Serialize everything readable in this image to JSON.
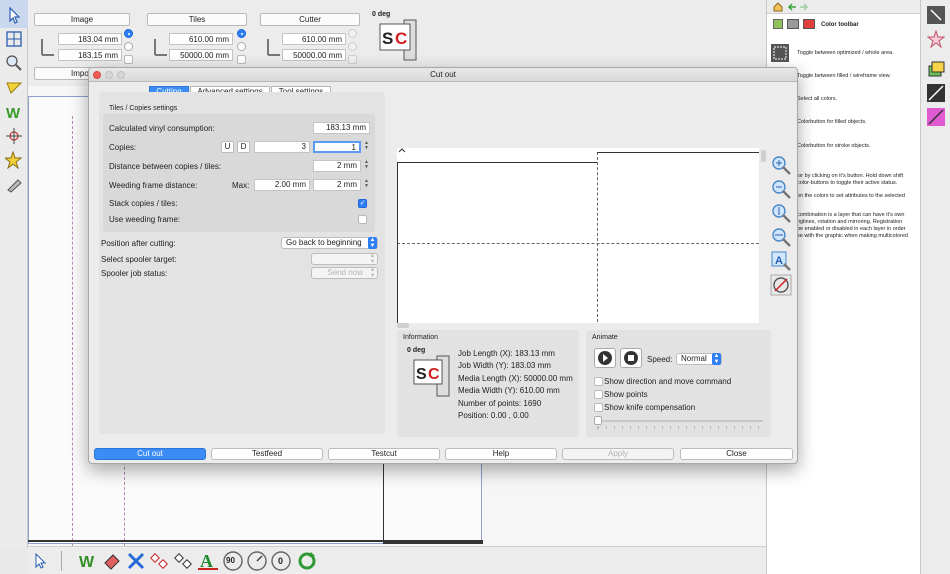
{
  "toolbar": {
    "image": {
      "label": "Image",
      "x_value": "183.04 mm",
      "y_value": "183.15 mm"
    },
    "tiles": {
      "label": "Tiles",
      "x_value": "610.00 mm",
      "y_value": "50000.00 mm"
    },
    "cutter": {
      "label": "Cutter",
      "x_value": "610.00 mm",
      "y_value": "50000.00 mm"
    },
    "rotation": "0 deg",
    "import_label": "Impo"
  },
  "left_tools": [
    "select-arrow-icon",
    "grid-icon",
    "zoom-icon",
    "pen-icon",
    "weed-icon",
    "crosshair-icon",
    "star-icon",
    "knife-icon"
  ],
  "bottom_tools": [
    "arrow-icon",
    "weed-icon",
    "eraser-icon",
    "cross-icon",
    "nodes-icon",
    "nodes-alt-icon",
    "text-icon",
    "rotate-90-icon",
    "rotate-icon",
    "rotate-0-icon",
    "refresh-icon"
  ],
  "bottom_tool_labels": {
    "rot90": "90",
    "rot0": "0"
  },
  "right_panel": {
    "title": "Color toolbar",
    "help": [
      "Toggle between optimized / whole area.",
      "Toggle between filled / wireframe view.",
      "Select all colors.",
      "Colorbutton for filled objects.",
      "Colorbutton for stroke objects.",
      "lor by clicking on it's button. Hold down shift",
      "color-buttons to toggle their active status.",
      "on the colors to set attributes to the selected",
      "combination is a layer that can have it's own",
      "nglines, rotation and mirroring. Registration",
      "be enabled or disabled in each layer in order",
      "se with the graphic when making multicolored"
    ]
  },
  "dialog": {
    "title": "Cut out",
    "tabs": [
      "Cutting",
      "Advanced settings",
      "Tool settings"
    ],
    "section_title": "Tiles / Copies settings",
    "vinyl_label": "Calculated vinyl consumption:",
    "vinyl_value": "183.13 mm",
    "copies_label": "Copies:",
    "copies_u": "U",
    "copies_d": "D",
    "copies_value": "3",
    "copies_value2": "1",
    "distance_label": "Distance between copies / tiles:",
    "distance_value": "2 mm",
    "weeding_label": "Weeding frame distance:",
    "weeding_max_label": "Max:",
    "weeding_max_value": "2.00 mm",
    "weeding_value": "2 mm",
    "stack_label": "Stack copies / tiles:",
    "use_weeding_label": "Use weeding frame:",
    "position_label": "Position after cutting:",
    "position_value": "Go back to beginning",
    "spooler_target_label": "Select spooler target:",
    "spooler_status_label": "Spooler job status:",
    "send_now": "Send now",
    "information": {
      "title": "Information",
      "rotation": "0 deg",
      "lines": [
        "Job Length (X): 183.13 mm",
        "Job Width (Y): 183.03 mm",
        "Media Length (X): 50000.00 mm",
        "Media Width (Y): 610.00 mm",
        "Number of points: 1690",
        "Position: 0.00 , 0.00"
      ]
    },
    "animate": {
      "title": "Animate",
      "speed_label": "Speed:",
      "speed_value": "Normal",
      "options": [
        "Show direction and move command",
        "Show points",
        "Show knife compensation"
      ]
    },
    "buttons": [
      "Cut out",
      "Testfeed",
      "Testcut",
      "Help",
      "Apply",
      "Close"
    ]
  },
  "colors": {
    "accent": "#3b8df5",
    "swatch_red": "#e03c3c",
    "swatch_gray": "#9a9a9a"
  }
}
